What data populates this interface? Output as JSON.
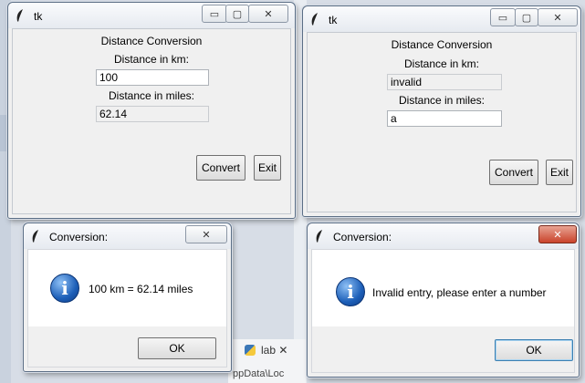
{
  "window_km": {
    "title": "tk",
    "heading": "Distance Conversion",
    "km_label": "Distance in km:",
    "km_value": "100",
    "miles_label": "Distance in miles:",
    "miles_value": "62.14",
    "convert_label": "Convert",
    "exit_label": "Exit"
  },
  "window_invalid": {
    "title": "tk",
    "heading": "Distance Conversion",
    "km_label": "Distance in km:",
    "km_value": "invalid",
    "miles_label": "Distance in miles:",
    "miles_value": "a",
    "convert_label": "Convert",
    "exit_label": "Exit"
  },
  "dialog_ok": {
    "title": "Conversion:",
    "message": "100 km = 62.14 miles",
    "ok_label": "OK"
  },
  "dialog_error": {
    "title": "Conversion:",
    "message": "Invalid entry, please enter a number",
    "ok_label": "OK"
  },
  "background": {
    "tab_label": "lab",
    "path_fragment": "ppData\\Loc"
  },
  "icons": {
    "window": "feather-icon",
    "dialog": "info-icon"
  }
}
